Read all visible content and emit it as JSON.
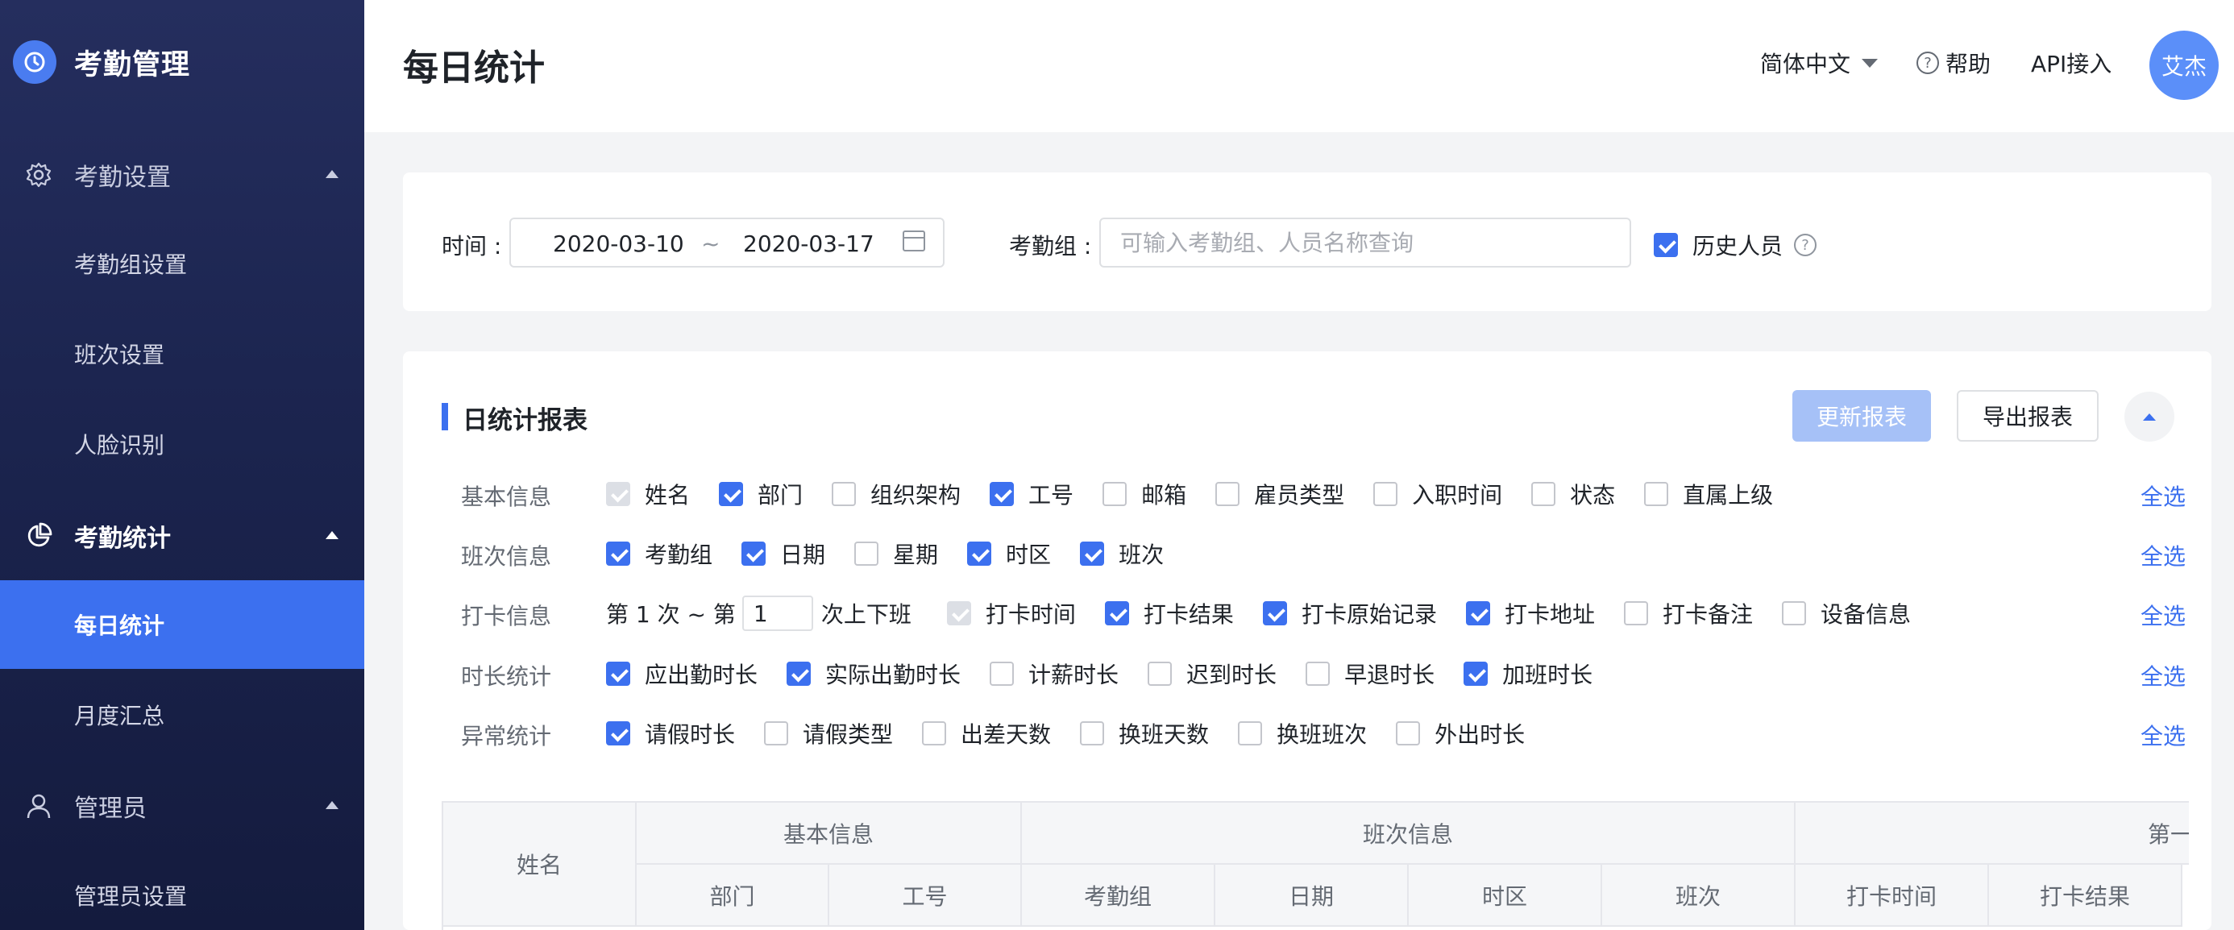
{
  "sidebar": {
    "brand": "考勤管理",
    "groups": [
      {
        "label": "考勤设置",
        "items": [
          "考勤组设置",
          "班次设置",
          "人脸识别"
        ]
      },
      {
        "label": "考勤统计",
        "items": [
          "每日统计",
          "月度汇总"
        ]
      },
      {
        "label": "管理员",
        "items": [
          "管理员设置"
        ]
      }
    ],
    "selected_item": "每日统计"
  },
  "header": {
    "title": "每日统计",
    "language": "简体中文",
    "help": "帮助",
    "api": "API接入",
    "avatar_text": "艾杰"
  },
  "filter": {
    "time_label": "时间 :",
    "start_date": "2020-03-10",
    "separator": "~",
    "end_date": "2020-03-17",
    "group_label": "考勤组 :",
    "group_placeholder": "可输入考勤组、人员名称查询",
    "history_label": "历史人员",
    "history_checked": true
  },
  "report": {
    "title": "日统计报表",
    "update_button": "更新报表",
    "export_button": "导出报表",
    "select_all": "全选",
    "rows": [
      {
        "label": "基本信息",
        "options": [
          {
            "label": "姓名",
            "state": "disabled"
          },
          {
            "label": "部门",
            "state": "checked"
          },
          {
            "label": "组织架构",
            "state": "unchecked"
          },
          {
            "label": "工号",
            "state": "checked"
          },
          {
            "label": "邮箱",
            "state": "unchecked"
          },
          {
            "label": "雇员类型",
            "state": "unchecked"
          },
          {
            "label": "入职时间",
            "state": "unchecked"
          },
          {
            "label": "状态",
            "state": "unchecked"
          },
          {
            "label": "直属上级",
            "state": "unchecked"
          }
        ]
      },
      {
        "label": "班次信息",
        "options": [
          {
            "label": "考勤组",
            "state": "checked"
          },
          {
            "label": "日期",
            "state": "checked"
          },
          {
            "label": "星期",
            "state": "unchecked"
          },
          {
            "label": "时区",
            "state": "checked"
          },
          {
            "label": "班次",
            "state": "checked"
          }
        ]
      },
      {
        "label": "打卡信息",
        "options": [
          {
            "label": "打卡时间",
            "state": "disabled"
          },
          {
            "label": "打卡结果",
            "state": "checked"
          },
          {
            "label": "打卡原始记录",
            "state": "checked"
          },
          {
            "label": "打卡地址",
            "state": "checked"
          },
          {
            "label": "打卡备注",
            "state": "unchecked"
          },
          {
            "label": "设备信息",
            "state": "unchecked"
          }
        ]
      },
      {
        "label": "时长统计",
        "options": [
          {
            "label": "应出勤时长",
            "state": "checked"
          },
          {
            "label": "实际出勤时长",
            "state": "checked"
          },
          {
            "label": "计薪时长",
            "state": "unchecked"
          },
          {
            "label": "迟到时长",
            "state": "unchecked"
          },
          {
            "label": "早退时长",
            "state": "unchecked"
          },
          {
            "label": "加班时长",
            "state": "checked"
          }
        ]
      },
      {
        "label": "异常统计",
        "options": [
          {
            "label": "请假时长",
            "state": "checked"
          },
          {
            "label": "请假类型",
            "state": "unchecked"
          },
          {
            "label": "出差天数",
            "state": "unchecked"
          },
          {
            "label": "换班天数",
            "state": "unchecked"
          },
          {
            "label": "换班班次",
            "state": "unchecked"
          },
          {
            "label": "外出时长",
            "state": "unchecked"
          }
        ]
      }
    ],
    "punch": {
      "prefix": "第 1 次 ~ 第",
      "value": "1",
      "suffix": "次上下班"
    },
    "table": {
      "name_header": "姓名",
      "groups": [
        "基本信息",
        "班次信息",
        "第一次"
      ],
      "columns": [
        "部门",
        "工号",
        "考勤组",
        "日期",
        "时区",
        "班次",
        "打卡时间",
        "打卡结果"
      ]
    }
  }
}
